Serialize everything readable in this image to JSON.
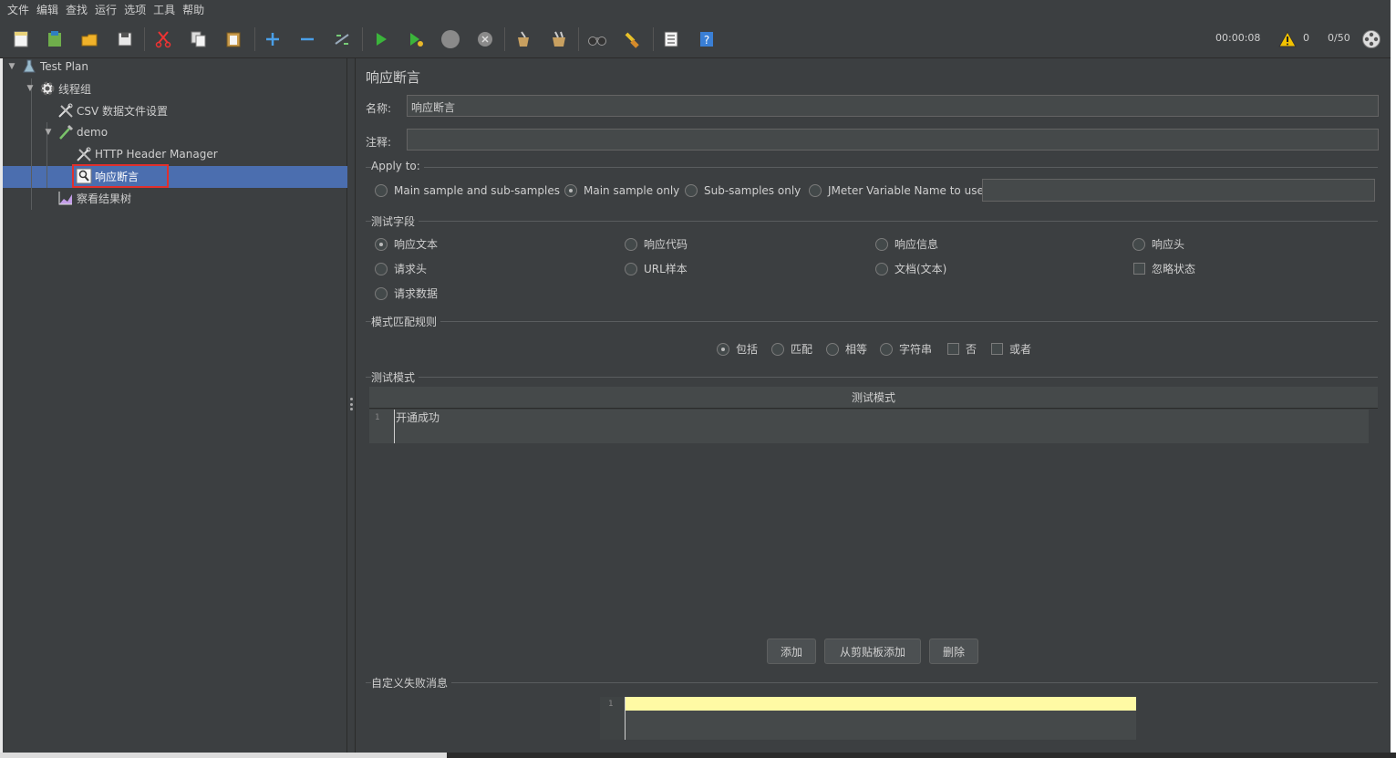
{
  "menu": [
    "文件",
    "编辑",
    "查找",
    "运行",
    "选项",
    "工具",
    "帮助"
  ],
  "toolbar": {
    "timer": "00:00:08",
    "warnings": "0",
    "threads": "0/50"
  },
  "tree": {
    "test_plan": "Test Plan",
    "thread_group": "线程组",
    "csv_config": "CSV 数据文件设置",
    "demo": "demo",
    "header_manager": "HTTP Header Manager",
    "response_assertion": "响应断言",
    "results_tree": "察看结果树"
  },
  "panel": {
    "title": "响应断言",
    "name_label": "名称:",
    "name_value": "响应断言",
    "comment_label": "注释:",
    "comment_value": "",
    "apply_to": {
      "label": "Apply to:",
      "options": [
        "Main sample and sub-samples",
        "Main sample only",
        "Sub-samples only",
        "JMeter Variable Name to use"
      ],
      "selected": "Main sample only",
      "variable_value": ""
    },
    "test_field": {
      "label": "测试字段",
      "options": [
        "响应文本",
        "响应代码",
        "响应信息",
        "响应头",
        "请求头",
        "URL样本",
        "文档(文本)",
        "忽略状态",
        "请求数据"
      ],
      "selected": "响应文本"
    },
    "match_rules": {
      "label": "模式匹配规则",
      "options": [
        "包括",
        "匹配",
        "相等",
        "字符串",
        "否",
        "或者"
      ],
      "selected": "包括"
    },
    "patterns": {
      "label": "测试模式",
      "column_header": "测试模式",
      "rows": [
        {
          "line": "1",
          "text": "开通成功"
        }
      ]
    },
    "buttons": {
      "add": "添加",
      "add_clipboard": "从剪贴板添加",
      "delete": "删除"
    },
    "failure_message": {
      "label": "自定义失败消息",
      "line": "1",
      "value": ""
    }
  }
}
